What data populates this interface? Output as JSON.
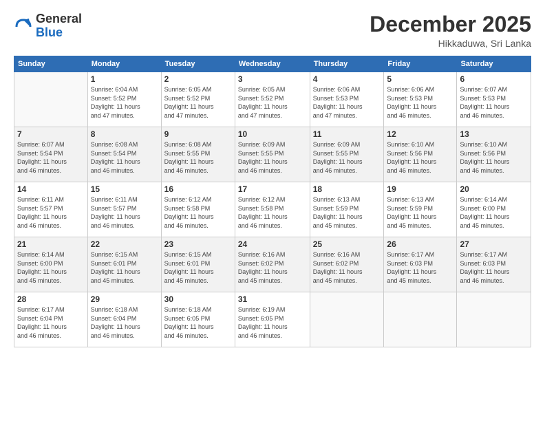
{
  "logo": {
    "general": "General",
    "blue": "Blue"
  },
  "header": {
    "title": "December 2025",
    "location": "Hikkaduwa, Sri Lanka"
  },
  "weekdays": [
    "Sunday",
    "Monday",
    "Tuesday",
    "Wednesday",
    "Thursday",
    "Friday",
    "Saturday"
  ],
  "weeks": [
    [
      {
        "day": "",
        "info": ""
      },
      {
        "day": "1",
        "info": "Sunrise: 6:04 AM\nSunset: 5:52 PM\nDaylight: 11 hours\nand 47 minutes."
      },
      {
        "day": "2",
        "info": "Sunrise: 6:05 AM\nSunset: 5:52 PM\nDaylight: 11 hours\nand 47 minutes."
      },
      {
        "day": "3",
        "info": "Sunrise: 6:05 AM\nSunset: 5:52 PM\nDaylight: 11 hours\nand 47 minutes."
      },
      {
        "day": "4",
        "info": "Sunrise: 6:06 AM\nSunset: 5:53 PM\nDaylight: 11 hours\nand 47 minutes."
      },
      {
        "day": "5",
        "info": "Sunrise: 6:06 AM\nSunset: 5:53 PM\nDaylight: 11 hours\nand 46 minutes."
      },
      {
        "day": "6",
        "info": "Sunrise: 6:07 AM\nSunset: 5:53 PM\nDaylight: 11 hours\nand 46 minutes."
      }
    ],
    [
      {
        "day": "7",
        "info": "Sunrise: 6:07 AM\nSunset: 5:54 PM\nDaylight: 11 hours\nand 46 minutes."
      },
      {
        "day": "8",
        "info": "Sunrise: 6:08 AM\nSunset: 5:54 PM\nDaylight: 11 hours\nand 46 minutes."
      },
      {
        "day": "9",
        "info": "Sunrise: 6:08 AM\nSunset: 5:55 PM\nDaylight: 11 hours\nand 46 minutes."
      },
      {
        "day": "10",
        "info": "Sunrise: 6:09 AM\nSunset: 5:55 PM\nDaylight: 11 hours\nand 46 minutes."
      },
      {
        "day": "11",
        "info": "Sunrise: 6:09 AM\nSunset: 5:55 PM\nDaylight: 11 hours\nand 46 minutes."
      },
      {
        "day": "12",
        "info": "Sunrise: 6:10 AM\nSunset: 5:56 PM\nDaylight: 11 hours\nand 46 minutes."
      },
      {
        "day": "13",
        "info": "Sunrise: 6:10 AM\nSunset: 5:56 PM\nDaylight: 11 hours\nand 46 minutes."
      }
    ],
    [
      {
        "day": "14",
        "info": "Sunrise: 6:11 AM\nSunset: 5:57 PM\nDaylight: 11 hours\nand 46 minutes."
      },
      {
        "day": "15",
        "info": "Sunrise: 6:11 AM\nSunset: 5:57 PM\nDaylight: 11 hours\nand 46 minutes."
      },
      {
        "day": "16",
        "info": "Sunrise: 6:12 AM\nSunset: 5:58 PM\nDaylight: 11 hours\nand 46 minutes."
      },
      {
        "day": "17",
        "info": "Sunrise: 6:12 AM\nSunset: 5:58 PM\nDaylight: 11 hours\nand 46 minutes."
      },
      {
        "day": "18",
        "info": "Sunrise: 6:13 AM\nSunset: 5:59 PM\nDaylight: 11 hours\nand 45 minutes."
      },
      {
        "day": "19",
        "info": "Sunrise: 6:13 AM\nSunset: 5:59 PM\nDaylight: 11 hours\nand 45 minutes."
      },
      {
        "day": "20",
        "info": "Sunrise: 6:14 AM\nSunset: 6:00 PM\nDaylight: 11 hours\nand 45 minutes."
      }
    ],
    [
      {
        "day": "21",
        "info": "Sunrise: 6:14 AM\nSunset: 6:00 PM\nDaylight: 11 hours\nand 45 minutes."
      },
      {
        "day": "22",
        "info": "Sunrise: 6:15 AM\nSunset: 6:01 PM\nDaylight: 11 hours\nand 45 minutes."
      },
      {
        "day": "23",
        "info": "Sunrise: 6:15 AM\nSunset: 6:01 PM\nDaylight: 11 hours\nand 45 minutes."
      },
      {
        "day": "24",
        "info": "Sunrise: 6:16 AM\nSunset: 6:02 PM\nDaylight: 11 hours\nand 45 minutes."
      },
      {
        "day": "25",
        "info": "Sunrise: 6:16 AM\nSunset: 6:02 PM\nDaylight: 11 hours\nand 45 minutes."
      },
      {
        "day": "26",
        "info": "Sunrise: 6:17 AM\nSunset: 6:03 PM\nDaylight: 11 hours\nand 45 minutes."
      },
      {
        "day": "27",
        "info": "Sunrise: 6:17 AM\nSunset: 6:03 PM\nDaylight: 11 hours\nand 46 minutes."
      }
    ],
    [
      {
        "day": "28",
        "info": "Sunrise: 6:17 AM\nSunset: 6:04 PM\nDaylight: 11 hours\nand 46 minutes."
      },
      {
        "day": "29",
        "info": "Sunrise: 6:18 AM\nSunset: 6:04 PM\nDaylight: 11 hours\nand 46 minutes."
      },
      {
        "day": "30",
        "info": "Sunrise: 6:18 AM\nSunset: 6:05 PM\nDaylight: 11 hours\nand 46 minutes."
      },
      {
        "day": "31",
        "info": "Sunrise: 6:19 AM\nSunset: 6:05 PM\nDaylight: 11 hours\nand 46 minutes."
      },
      {
        "day": "",
        "info": ""
      },
      {
        "day": "",
        "info": ""
      },
      {
        "day": "",
        "info": ""
      }
    ]
  ]
}
